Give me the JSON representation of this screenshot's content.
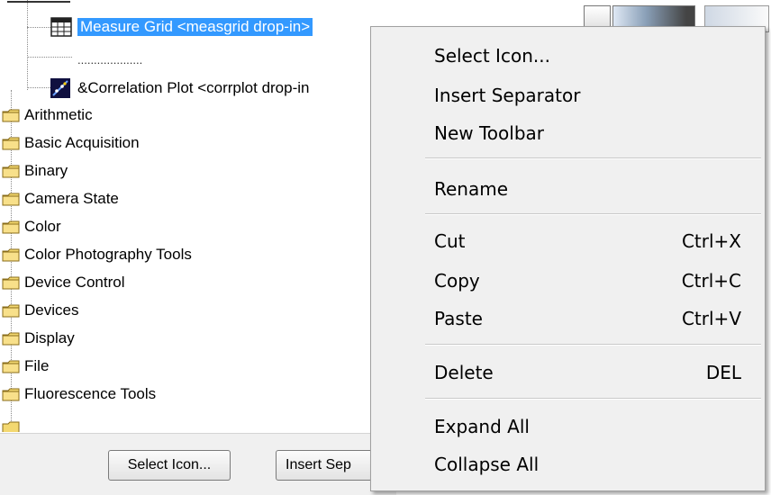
{
  "tree": {
    "drop_ins": [
      {
        "label": "Measure Grid <measgrid drop-in>",
        "icon": "grid-icon",
        "selected": true
      },
      {
        "label": "....................",
        "icon": "separator"
      },
      {
        "label": "&Correlation Plot <corrplot drop-in",
        "icon": "plot-icon"
      }
    ],
    "folders": [
      "Arithmetic",
      "Basic Acquisition",
      "Binary",
      "Camera State",
      "Color",
      "Color Photography Tools",
      "Device Control",
      "Devices",
      "Display",
      "File",
      "Fluorescence Tools"
    ]
  },
  "bottom_bar": {
    "select_icon_label": "Select Icon...",
    "insert_sep_label": "Insert Sep"
  },
  "context_menu": {
    "items": [
      {
        "label": "Select Icon...",
        "shortcut": ""
      },
      {
        "label": "Insert Separator",
        "shortcut": ""
      },
      {
        "label": "New Toolbar",
        "shortcut": ""
      },
      {
        "label": "Rename",
        "shortcut": ""
      },
      {
        "label": "Cut",
        "shortcut": "Ctrl+X"
      },
      {
        "label": "Copy",
        "shortcut": "Ctrl+C"
      },
      {
        "label": "Paste",
        "shortcut": "Ctrl+V"
      },
      {
        "label": "Delete",
        "shortcut": "DEL"
      },
      {
        "label": "Expand All",
        "shortcut": ""
      },
      {
        "label": "Collapse All",
        "shortcut": ""
      }
    ]
  },
  "colors": {
    "selection": "#3399ff",
    "folder": "#f3d870",
    "menu_bg": "#f0f0f0"
  }
}
